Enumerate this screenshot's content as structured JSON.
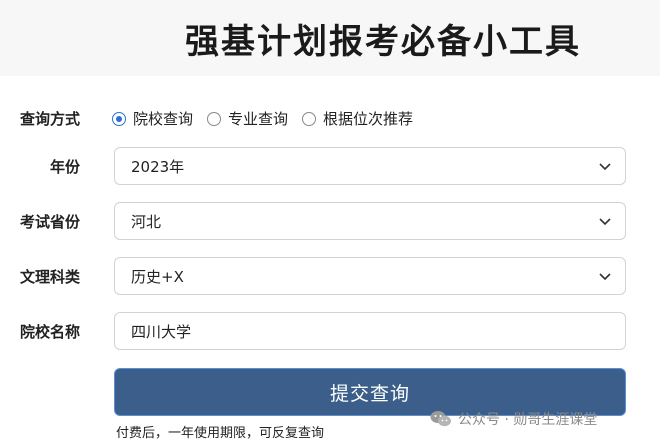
{
  "header": {
    "title": "强基计划报考必备小工具"
  },
  "form": {
    "query_mode": {
      "label": "查询方式",
      "options": [
        "院校查询",
        "专业查询",
        "根据位次推荐"
      ],
      "selected_index": 0
    },
    "year": {
      "label": "年份",
      "value": "2023年"
    },
    "province": {
      "label": "考试省份",
      "value": "河北"
    },
    "subject": {
      "label": "文理科类",
      "value": "历史+X"
    },
    "school": {
      "label": "院校名称",
      "value": "四川大学"
    },
    "submit_label": "提交查询",
    "note": "付费后，一年使用期限，可反复查询"
  },
  "watermark": {
    "text": "公众号 · 勋哥生涯课堂",
    "icon": "wechat-icon"
  },
  "colors": {
    "accent": "#2b6fd6",
    "button": "#3b5f8a"
  }
}
